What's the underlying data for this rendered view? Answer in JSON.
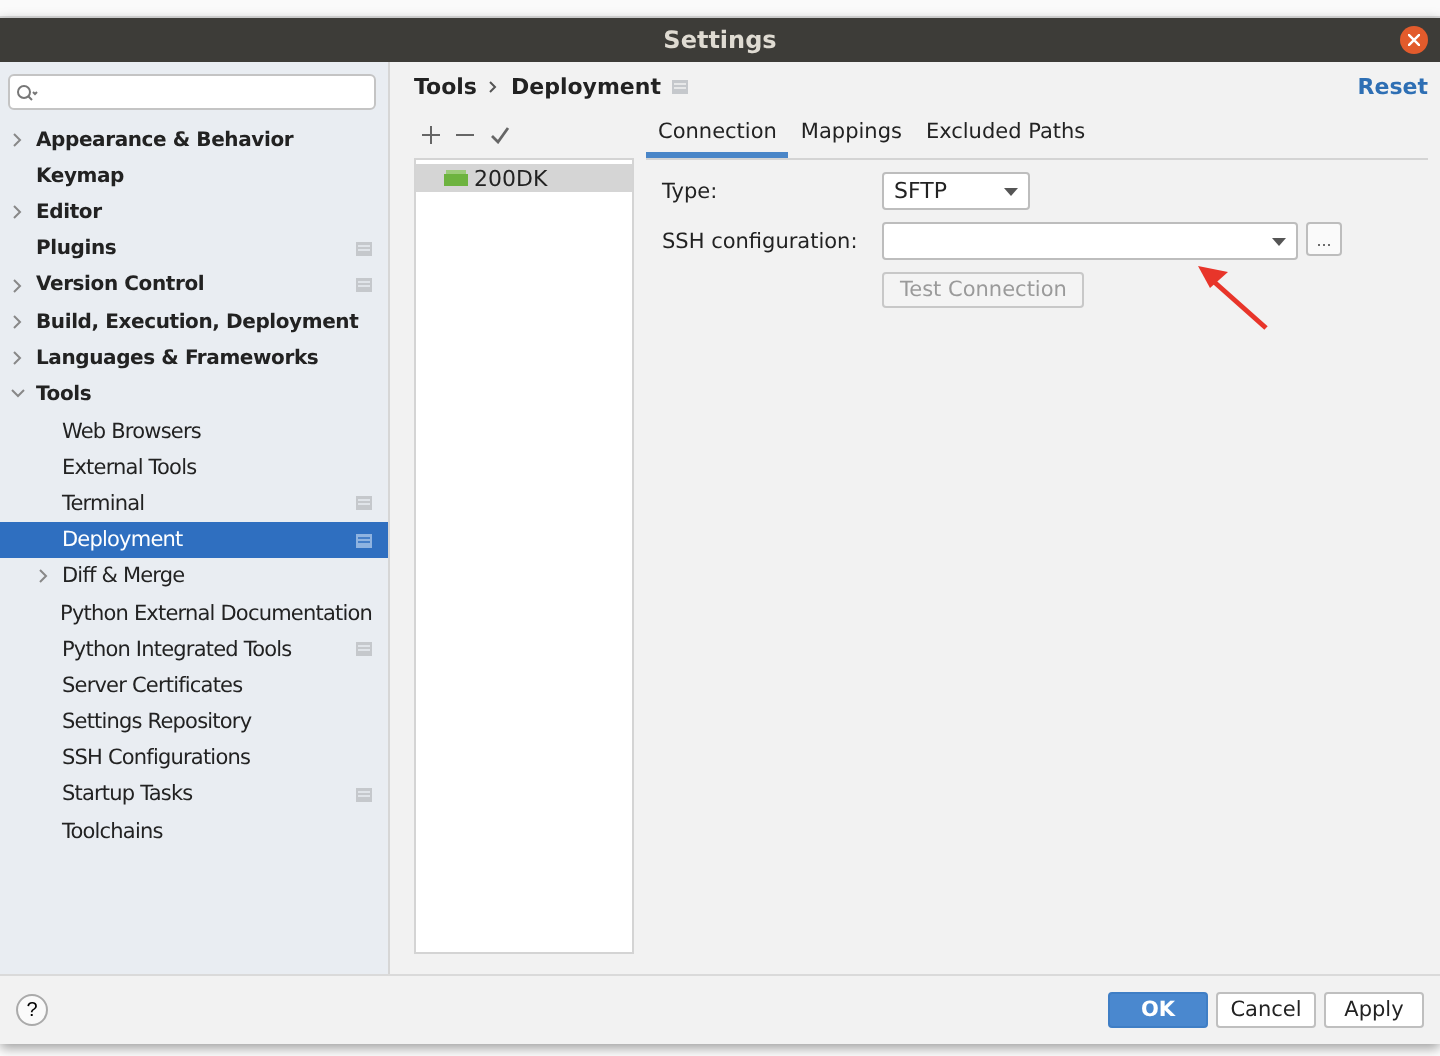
{
  "window": {
    "title": "Settings"
  },
  "sidebar": {
    "items": [
      {
        "label": "Appearance & Behavior",
        "expandable": true,
        "expanded": false,
        "project_scoped": false,
        "selected": false
      },
      {
        "label": "Keymap",
        "expandable": false,
        "project_scoped": false,
        "selected": false
      },
      {
        "label": "Editor",
        "expandable": true,
        "expanded": false,
        "project_scoped": false,
        "selected": false
      },
      {
        "label": "Plugins",
        "expandable": false,
        "project_scoped": true,
        "selected": false
      },
      {
        "label": "Version Control",
        "expandable": true,
        "expanded": false,
        "project_scoped": true,
        "selected": false
      },
      {
        "label": "Build, Execution, Deployment",
        "expandable": true,
        "expanded": false,
        "project_scoped": false,
        "selected": false
      },
      {
        "label": "Languages & Frameworks",
        "expandable": true,
        "expanded": false,
        "project_scoped": false,
        "selected": false
      },
      {
        "label": "Tools",
        "expandable": true,
        "expanded": true,
        "project_scoped": false,
        "selected": false,
        "children": [
          {
            "label": "Web Browsers",
            "expandable": false,
            "project_scoped": false,
            "selected": false
          },
          {
            "label": "External Tools",
            "expandable": false,
            "project_scoped": false,
            "selected": false
          },
          {
            "label": "Terminal",
            "expandable": false,
            "project_scoped": true,
            "selected": false
          },
          {
            "label": "Deployment",
            "expandable": false,
            "project_scoped": true,
            "selected": true
          },
          {
            "label": "Diff & Merge",
            "expandable": true,
            "expanded": false,
            "project_scoped": false,
            "selected": false
          },
          {
            "label": "Python External Documentation",
            "expandable": false,
            "project_scoped": false,
            "selected": false
          },
          {
            "label": "Python Integrated Tools",
            "expandable": false,
            "project_scoped": true,
            "selected": false
          },
          {
            "label": "Server Certificates",
            "expandable": false,
            "project_scoped": false,
            "selected": false
          },
          {
            "label": "Settings Repository",
            "expandable": false,
            "project_scoped": false,
            "selected": false
          },
          {
            "label": "SSH Configurations",
            "expandable": false,
            "project_scoped": false,
            "selected": false
          },
          {
            "label": "Startup Tasks",
            "expandable": false,
            "project_scoped": true,
            "selected": false
          },
          {
            "label": "Toolchains",
            "expandable": false,
            "project_scoped": false,
            "selected": false
          }
        ]
      }
    ]
  },
  "breadcrumb": [
    "Tools",
    "Deployment"
  ],
  "reset": "Reset",
  "servers": [
    {
      "name": "200DK",
      "selected": true
    }
  ],
  "tabs": [
    {
      "label": "Connection",
      "selected": true
    },
    {
      "label": "Mappings",
      "selected": false
    },
    {
      "label": "Excluded Paths",
      "selected": false
    }
  ],
  "form": {
    "type_label": "Type:",
    "type_value": "SFTP",
    "ssh_label": "SSH configuration:",
    "browse": "...",
    "test_button": {
      "label": "Test Connection",
      "disabled": true
    }
  },
  "footer": {
    "help": "?",
    "buttons": [
      {
        "label": "OK",
        "kind": "primary"
      },
      {
        "label": "Cancel",
        "kind": "normal"
      },
      {
        "label": "Apply",
        "kind": "normal"
      }
    ]
  }
}
